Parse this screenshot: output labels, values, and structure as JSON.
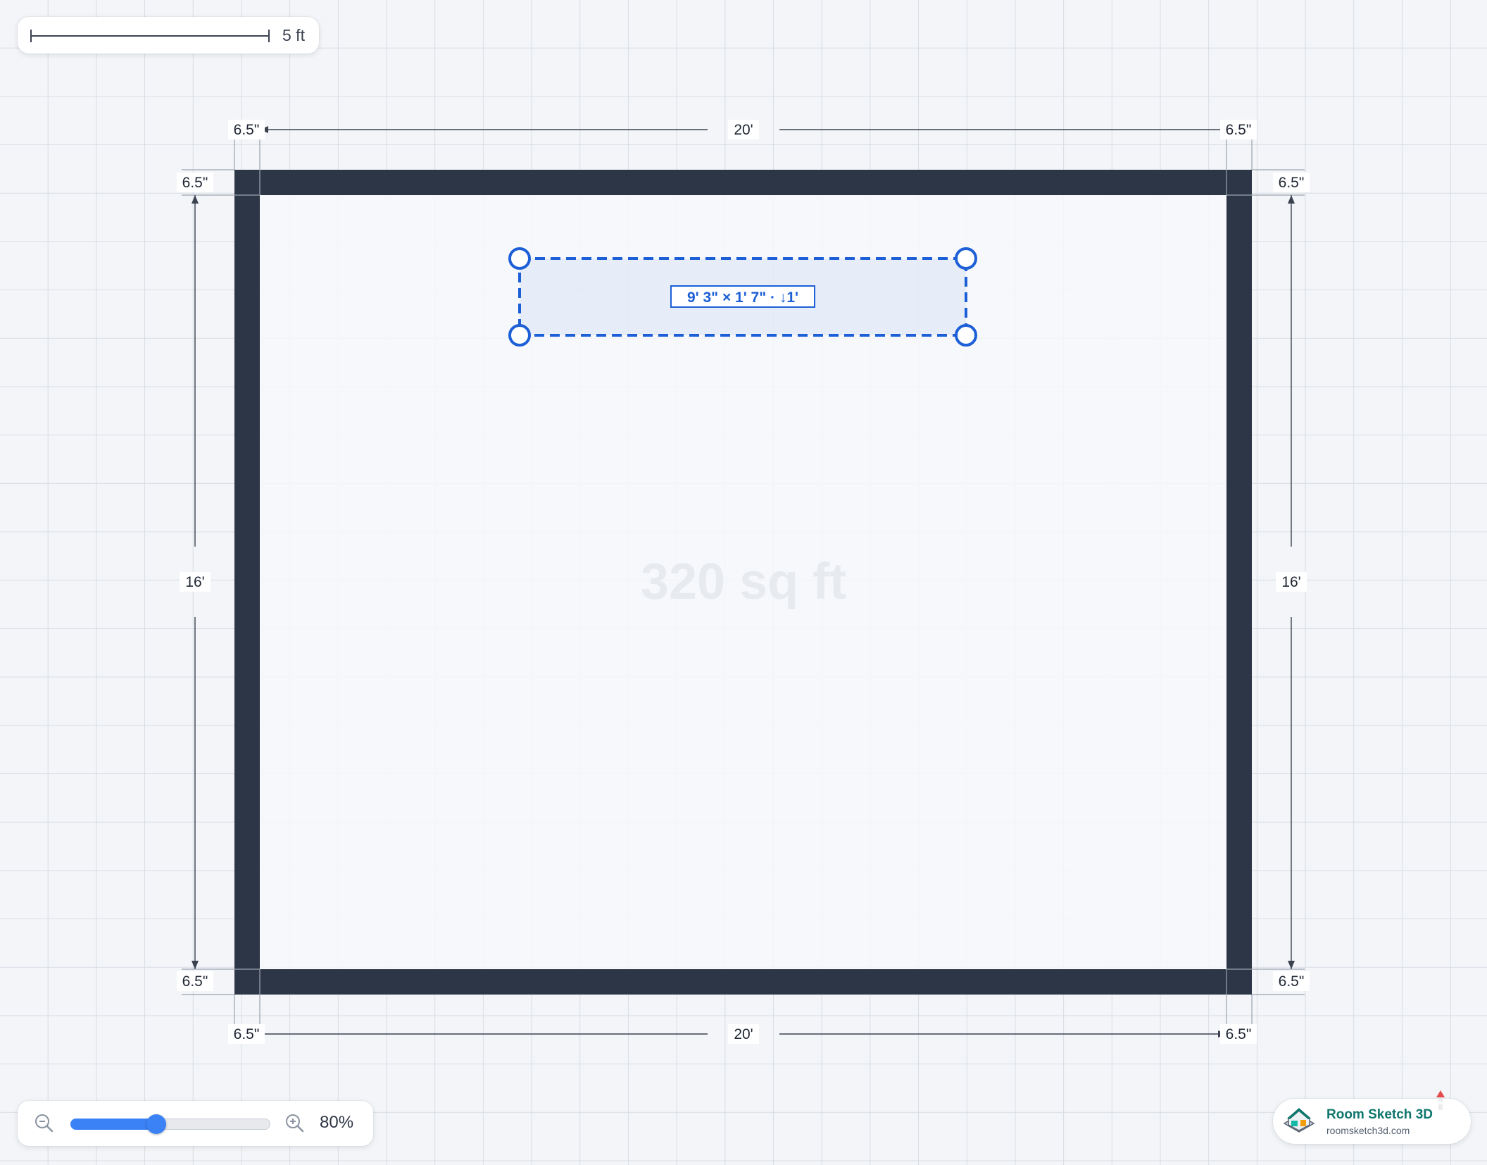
{
  "scale_bar": {
    "label": "5 ft"
  },
  "room": {
    "area_label": "320 sq ft",
    "wall_color": "#2c3646",
    "floor_color": "#f7f8fb",
    "width_label": "20'",
    "height_label": "16'",
    "wall_thickness_label": "6.5\""
  },
  "selection": {
    "label": "9' 3\" × 1' 7\" · ↓1'",
    "color": "#1d5fd6"
  },
  "zoom": {
    "value_label": "80%",
    "level": 0.43,
    "zoom_out_icon": "zoom-out-icon",
    "zoom_in_icon": "zoom-in-icon"
  },
  "brand": {
    "name": "Room Sketch 3D",
    "url": "roomsketch3d.com",
    "logo_icon": "house-icon"
  }
}
